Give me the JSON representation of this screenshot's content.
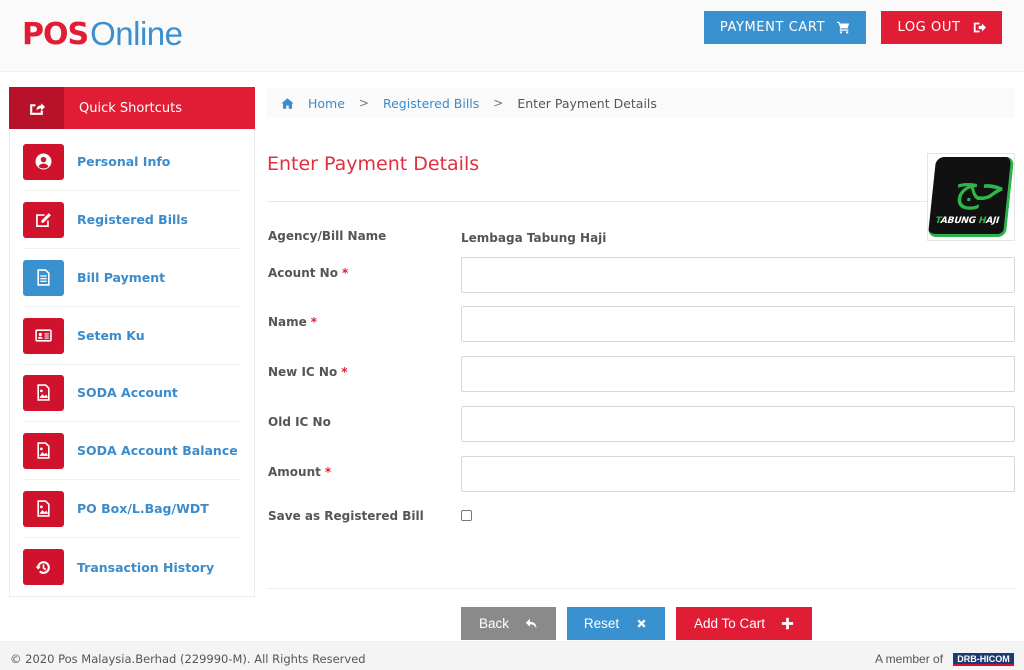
{
  "header": {
    "logo_pos": "POS",
    "logo_online": "Online",
    "payment_cart_label": "PAYMENT CART",
    "logout_label": "LOG OUT"
  },
  "sidebar": {
    "title": "Quick Shortcuts",
    "items": [
      {
        "label": "Personal Info",
        "icon": "user-circle-icon",
        "color": "#d0122d"
      },
      {
        "label": "Registered Bills",
        "icon": "edit-icon",
        "color": "#d0122d"
      },
      {
        "label": "Bill Payment",
        "icon": "file-text-icon",
        "color": "#3a91d0"
      },
      {
        "label": "Setem Ku",
        "icon": "id-card-icon",
        "color": "#d0122d"
      },
      {
        "label": "SODA Account",
        "icon": "file-image-icon",
        "color": "#d0122d"
      },
      {
        "label": "SODA Account Balance",
        "icon": "file-image-icon",
        "color": "#d0122d"
      },
      {
        "label": "PO Box/L.Bag/WDT",
        "icon": "file-image-icon",
        "color": "#d0122d"
      },
      {
        "label": "Transaction History",
        "icon": "history-icon",
        "color": "#d0122d"
      }
    ]
  },
  "breadcrumb": {
    "home": "Home",
    "registered_bills": "Registered Bills",
    "current": "Enter Payment Details",
    "separator": ">"
  },
  "main": {
    "title": "Enter Payment Details",
    "agency_logo_text_a": "T",
    "agency_logo_text_b": "ABUNG ",
    "agency_logo_text_c": "H",
    "agency_logo_text_d": "AJI",
    "agency_logo_glyph": "ﺣﺞ",
    "form": {
      "agency_label": "Agency/Bill Name",
      "agency_value": "Lembaga Tabung Haji",
      "fields": [
        {
          "label": "Acount No",
          "required": true,
          "value": "",
          "placeholder": ""
        },
        {
          "label": "Name",
          "required": true,
          "value": "",
          "placeholder": ""
        },
        {
          "label": "New IC No",
          "required": true,
          "value": "",
          "placeholder": ""
        },
        {
          "label": "Old IC No",
          "required": false,
          "value": "",
          "placeholder": ""
        },
        {
          "label": "Amount",
          "required": true,
          "value": "",
          "placeholder": ""
        }
      ],
      "required_marker": "*",
      "save_label": "Save as Registered Bill",
      "save_checked": false
    },
    "buttons": {
      "back": "Back",
      "reset": "Reset",
      "add_to_cart": "Add To Cart"
    }
  },
  "footer": {
    "copyright": "© 2020 Pos Malaysia.Berhad (229990-M). All Rights Reserved",
    "member_of": "A member of",
    "member_logo": "DRB-HICOM"
  },
  "colors": {
    "brand_red": "#e11d35",
    "brand_blue": "#3a91d0",
    "link_blue": "#3a8ccc",
    "back_grey": "#8a8a8a"
  }
}
